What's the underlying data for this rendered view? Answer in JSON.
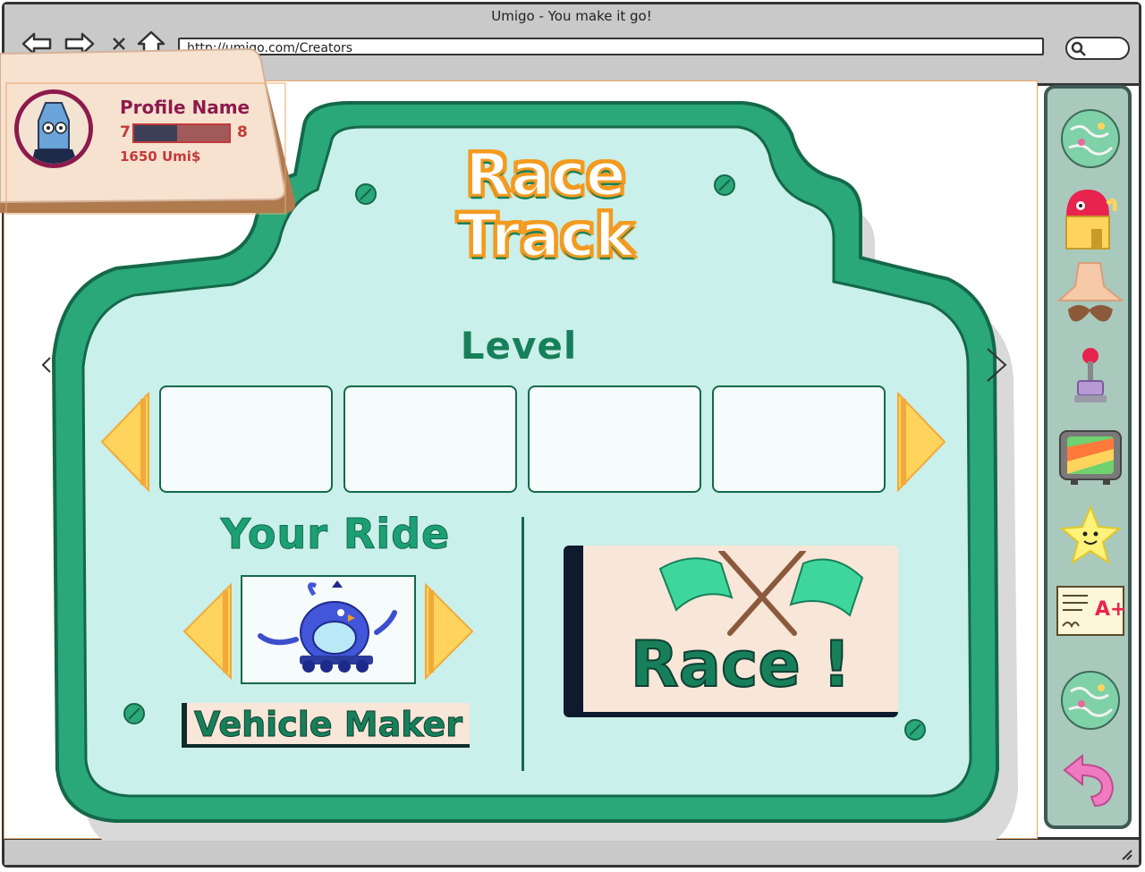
{
  "window": {
    "title": "Umigo - You make it go!",
    "url": "http://umigo.com/Creators"
  },
  "nav": {
    "back_icon": "back-arrow-icon",
    "forward_icon": "forward-arrow-icon",
    "stop_icon": "close-icon",
    "home_icon": "home-icon",
    "search_icon": "search-icon"
  },
  "profile": {
    "name": "Profile Name",
    "level_current": "7",
    "level_next": "8",
    "xp_progress": 0.45,
    "currency": "1650 Umi$"
  },
  "board": {
    "title_line1": "Race",
    "title_line2": "Track",
    "level_label": "Level",
    "level_slots": 4,
    "your_ride_label": "Your Ride",
    "vehicle_maker_label": "Vehicle Maker",
    "race_button_label": "Race !"
  },
  "colors": {
    "board_frame": "#2aa87a",
    "board_inner": "#c9f0ea",
    "arrow_fill": "#ffd45c",
    "title_orange": "#f39b20",
    "text_green": "#17805a",
    "profile_accent": "#8d1a4d"
  },
  "sidebar": {
    "items": [
      {
        "icon": "globe-map-icon"
      },
      {
        "icon": "pink-house-icon"
      },
      {
        "icon": "mustache-face-icon"
      },
      {
        "icon": "joystick-icon"
      },
      {
        "icon": "tv-icon"
      },
      {
        "icon": "star-icon"
      },
      {
        "icon": "report-card-icon"
      },
      {
        "icon": "globe-map-icon"
      },
      {
        "icon": "back-arrow-pink-icon"
      }
    ]
  }
}
